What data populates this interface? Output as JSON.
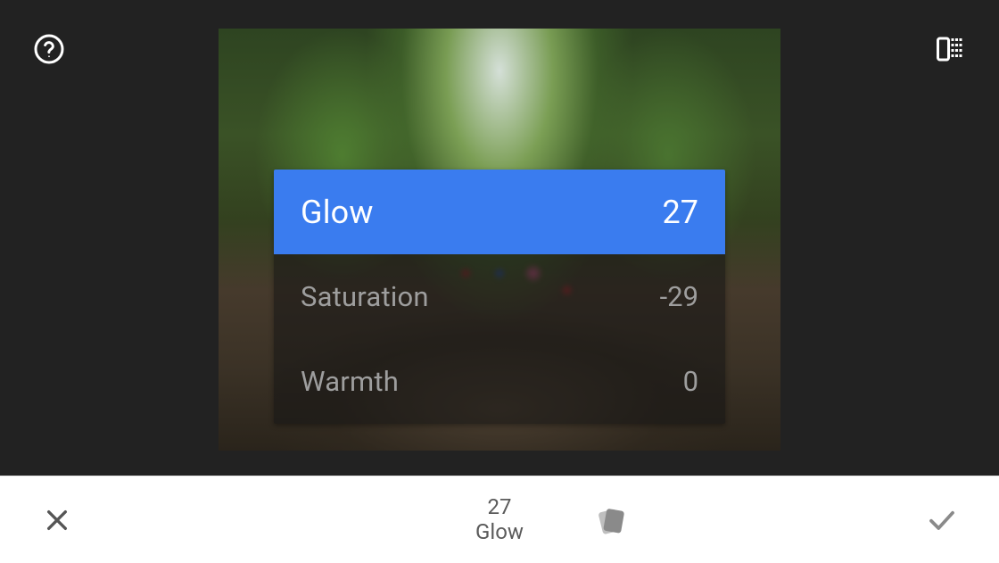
{
  "adjustments": [
    {
      "label": "Glow",
      "value": "27",
      "selected": true
    },
    {
      "label": "Saturation",
      "value": "-29",
      "selected": false
    },
    {
      "label": "Warmth",
      "value": "0",
      "selected": false
    }
  ],
  "bottom": {
    "current_value": "27",
    "current_label": "Glow"
  },
  "icons": {
    "help": "help-circle-icon",
    "compare": "compare-icon",
    "close": "close-icon",
    "confirm": "check-icon",
    "styles": "styles-swatch-icon"
  },
  "colors": {
    "accent": "#3a7cef",
    "editor_bg": "#222222",
    "bottom_bg": "#ffffff",
    "bottom_text": "#5b5b5b",
    "muted_text": "#9e9e9e"
  }
}
